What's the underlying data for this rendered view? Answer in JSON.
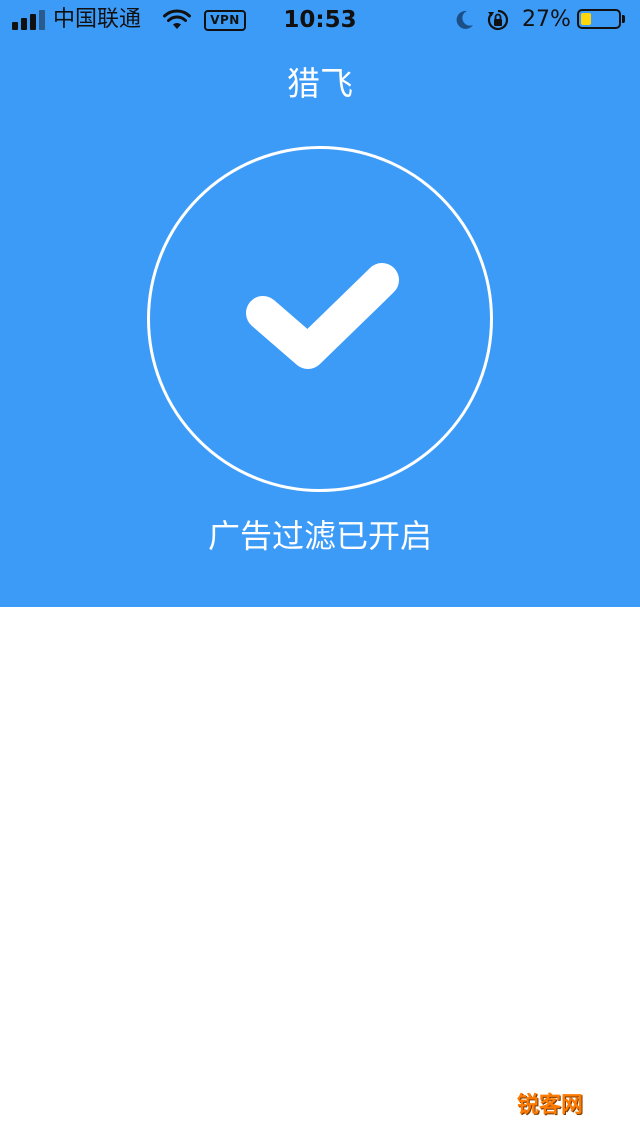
{
  "status_bar": {
    "carrier": "中国联通",
    "vpn_label": "VPN",
    "time": "10:53",
    "battery_percent": "27%",
    "battery_level": 0.27,
    "signal_bars": 4,
    "signal_strength": 3,
    "icons": [
      "signal-icon",
      "wifi-icon",
      "vpn-icon",
      "moon-icon",
      "rotation-lock-icon",
      "battery-icon"
    ]
  },
  "header": {
    "title": "猎飞"
  },
  "main": {
    "status_icon": "checkmark-icon",
    "status_text": "广告过滤已开启"
  },
  "colors": {
    "primary": "#3d9bf8",
    "on_primary": "#ffffff",
    "background": "#ffffff",
    "battery_fill": "#ffd60a"
  },
  "watermark": {
    "text": "锐客网"
  }
}
